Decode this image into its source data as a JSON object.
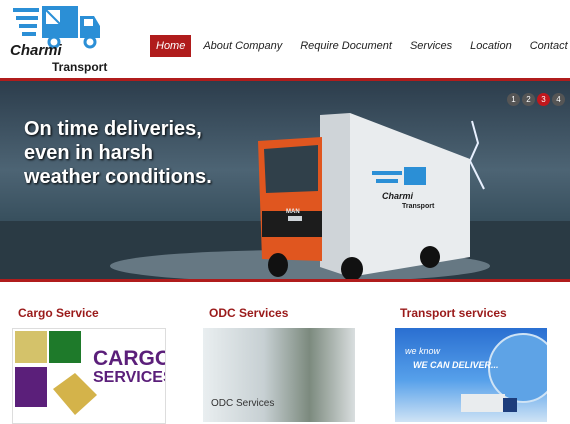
{
  "logo": {
    "line1": "Charmi",
    "line2": "Transport",
    "icon": "delivery-truck-icon"
  },
  "nav": {
    "items": [
      {
        "label": "Home",
        "active": true
      },
      {
        "label": "About Company",
        "active": false
      },
      {
        "label": "Require Document",
        "active": false
      },
      {
        "label": "Services",
        "active": false
      },
      {
        "label": "Location",
        "active": false
      },
      {
        "label": "Contact Us",
        "active": false
      }
    ]
  },
  "hero": {
    "caption": "On time deliveries,\neven in harsh\nweather conditions.",
    "truck_brand": "MAN",
    "truck_logo_line1": "Charmi",
    "truck_logo_line2": "Transport",
    "slides": [
      "1",
      "2",
      "3",
      "4"
    ],
    "active_slide": "3"
  },
  "services": [
    {
      "title": "Cargo Service",
      "image_text_line1": "CARGO",
      "image_text_line2": "SERVICES"
    },
    {
      "title": "ODC Services",
      "image_text": "ODC Services"
    },
    {
      "title": "Transport services",
      "image_text_line1": "we know",
      "image_text_line2": "WE CAN DELIVER..."
    }
  ],
  "colors": {
    "accent": "#b01c1c",
    "cargo_purple": "#5b1f7a"
  }
}
